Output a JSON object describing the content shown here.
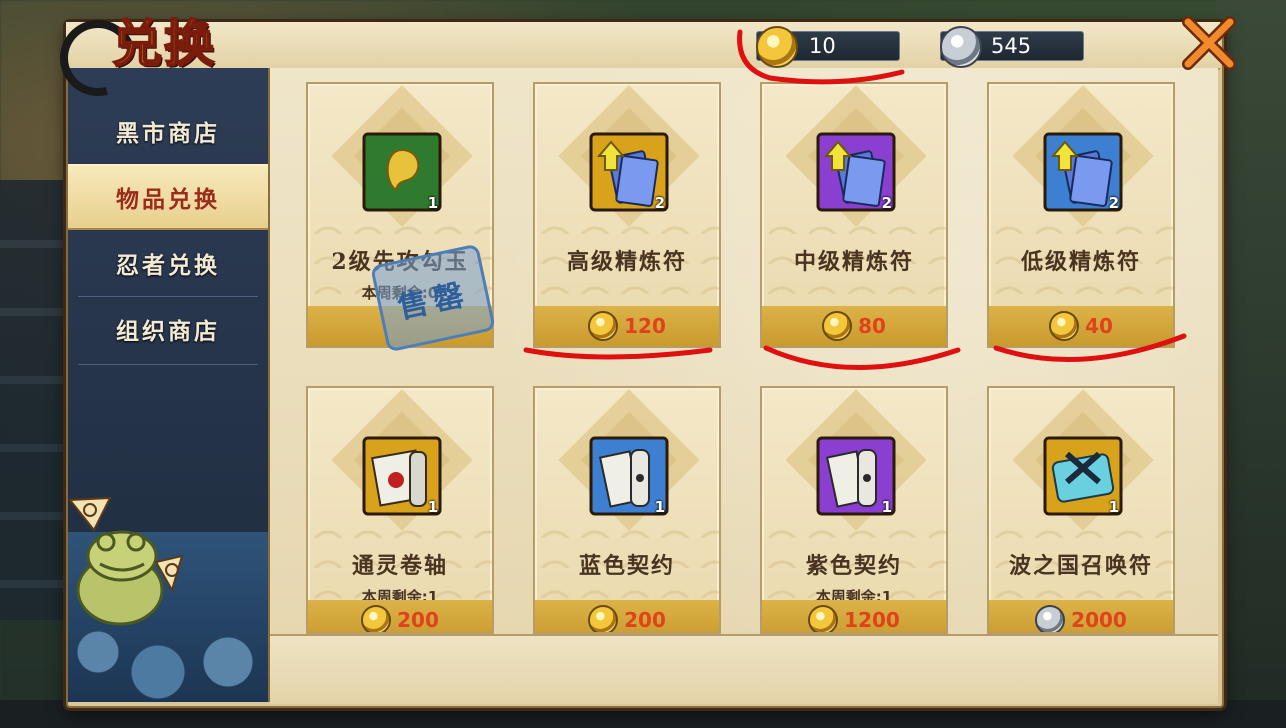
{
  "title": "兑换",
  "currency": {
    "gold_amount": "10",
    "silver_amount": "545"
  },
  "sidebar": {
    "items": [
      {
        "label": "黑市商店",
        "active": false
      },
      {
        "label": "物品兑换",
        "active": true
      },
      {
        "label": "忍者兑换",
        "active": false
      },
      {
        "label": "组织商店",
        "active": false
      }
    ]
  },
  "items": [
    {
      "name": "2级先攻勾玉",
      "qty": "1",
      "sub": "本周剩余:0",
      "price": "",
      "currency": "gold",
      "sold_out": true,
      "sold_out_label": "售罄",
      "icon": "magatama-icon",
      "frame": "#2e7a2e"
    },
    {
      "name": "高级精炼符",
      "qty": "2",
      "sub": "",
      "price": "120",
      "currency": "gold",
      "sold_out": false,
      "icon": "refine-scroll-icon",
      "frame": "#d9a21b"
    },
    {
      "name": "中级精炼符",
      "qty": "2",
      "sub": "",
      "price": "80",
      "currency": "gold",
      "sold_out": false,
      "icon": "refine-scroll-icon",
      "frame": "#8a3fd0"
    },
    {
      "name": "低级精炼符",
      "qty": "2",
      "sub": "",
      "price": "40",
      "currency": "gold",
      "sold_out": false,
      "icon": "refine-scroll-icon",
      "frame": "#3d7fd0"
    },
    {
      "name": "通灵卷轴",
      "qty": "1",
      "sub": "本周剩余:1",
      "price": "200",
      "currency": "gold",
      "sold_out": false,
      "icon": "summon-scroll-icon",
      "frame": "#d9a21b"
    },
    {
      "name": "蓝色契约",
      "qty": "1",
      "sub": "",
      "price": "200",
      "currency": "gold",
      "sold_out": false,
      "icon": "contract-scroll-icon",
      "frame": "#3d7fd0"
    },
    {
      "name": "紫色契约",
      "qty": "1",
      "sub": "本周剩余:1",
      "price": "1200",
      "currency": "gold",
      "sold_out": false,
      "icon": "contract-scroll-icon",
      "frame": "#8a3fd0"
    },
    {
      "name": "波之国召唤符",
      "qty": "1",
      "sub": "",
      "price": "2000",
      "currency": "silver",
      "sold_out": false,
      "icon": "land-of-waves-scroll-icon",
      "frame": "#d9a21b"
    }
  ],
  "colors": {
    "gold": "#f3c63b",
    "price_red": "#e0421a",
    "annotation_red": "#e01010"
  }
}
